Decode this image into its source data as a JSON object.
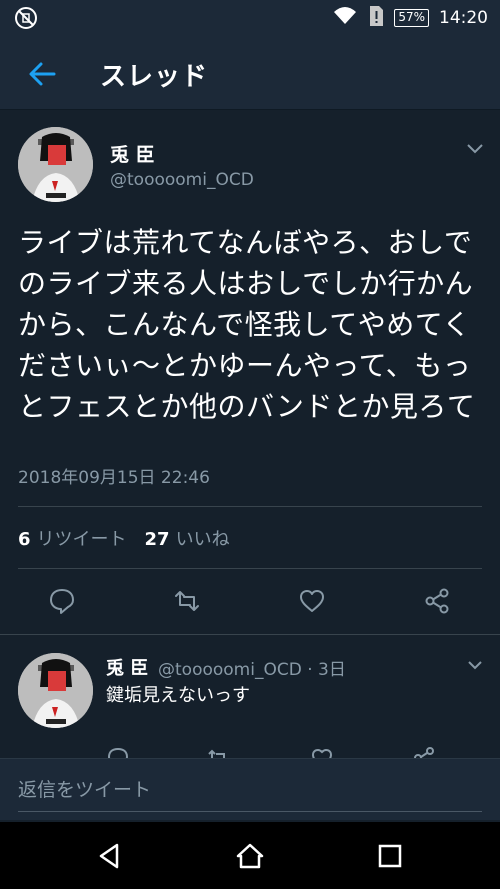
{
  "status_bar": {
    "battery": "57%",
    "time": "14:20",
    "icons": [
      "no-sim-icon",
      "wifi-icon",
      "sim-alert-icon",
      "battery-icon"
    ]
  },
  "app_bar": {
    "title": "スレッド",
    "back_icon": "back-arrow-icon"
  },
  "tweet": {
    "author_name": "兎 臣",
    "author_handle": "@tooooomi_OCD",
    "text": "ライブは荒れてなんぼやろ、おしでのライブ来る人はおしでしか行かんから、こんなんで怪我してやめてくださいぃ〜とかゆーんやって、もっとフェスとか他のバンドとか見ろて",
    "timestamp": "2018年09月15日 22:46",
    "retweet_count": "6",
    "retweet_label": "リツイート",
    "like_count": "27",
    "like_label": "いいね",
    "actions": [
      "reply-icon",
      "retweet-icon",
      "like-icon",
      "share-icon"
    ]
  },
  "reply": {
    "author_name": "兎 臣",
    "meta": "@tooooomi_OCD · 3日",
    "text": "鍵垢見えないっす"
  },
  "compose": {
    "placeholder": "返信をツイート"
  },
  "colors": {
    "background": "#15202b",
    "bar": "#1c2938",
    "secondary_text": "#8899a6",
    "accent": "#1da1f2"
  },
  "nav": [
    "back-triangle-icon",
    "home-circle-icon",
    "recents-square-icon"
  ]
}
